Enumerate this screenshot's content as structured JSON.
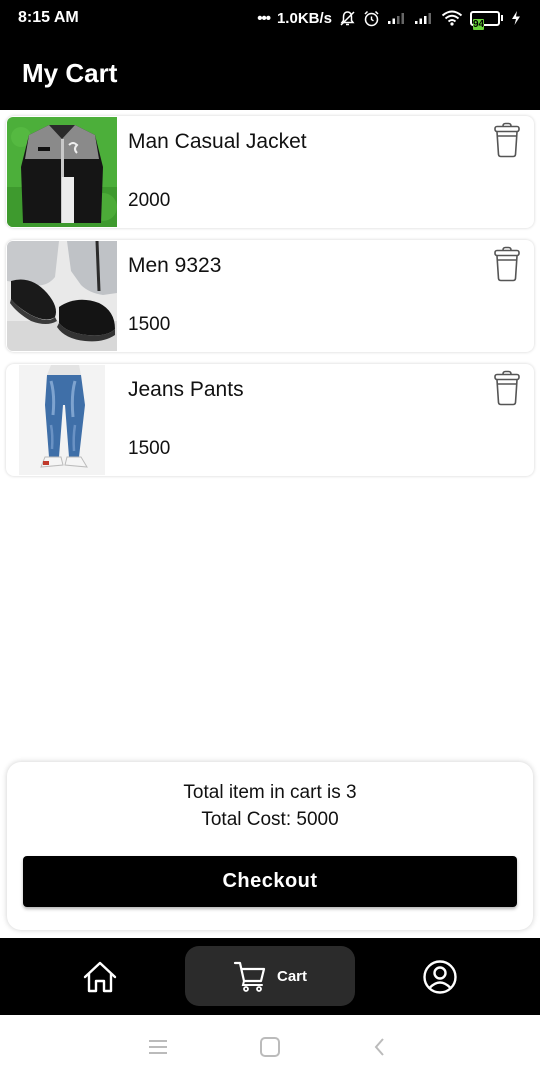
{
  "status_bar": {
    "time": "8:15 AM",
    "network_speed": "1.0KB/s",
    "battery_level": "94",
    "icons": [
      "dots-icon",
      "mute-icon",
      "alarm-icon",
      "signal-icon",
      "signal-icon",
      "wifi-icon",
      "battery-icon",
      "charging-icon"
    ]
  },
  "app_bar": {
    "title": "My Cart"
  },
  "cart": {
    "items": [
      {
        "name": "Man Casual Jacket",
        "price": "2000",
        "image": "jacket-photo"
      },
      {
        "name": "Men 9323",
        "price": "1500",
        "image": "shoes-photo"
      },
      {
        "name": "Jeans Pants",
        "price": "1500",
        "image": "jeans-photo"
      }
    ]
  },
  "summary": {
    "items_text": "Total item in cart is 3",
    "cost_text": "Total Cost: 5000",
    "checkout_label": "Checkout"
  },
  "bottom_nav": {
    "items": [
      {
        "icon": "home-icon",
        "label": ""
      },
      {
        "icon": "cart-icon",
        "label": "Cart",
        "active": true
      },
      {
        "icon": "profile-icon",
        "label": ""
      }
    ]
  },
  "system_nav": {
    "icons": [
      "menu-icon",
      "home-square-icon",
      "back-icon"
    ]
  },
  "colors": {
    "bar_background": "#000000",
    "active_tab": "#2b2b2b",
    "battery_fill": "#6bd43a"
  }
}
